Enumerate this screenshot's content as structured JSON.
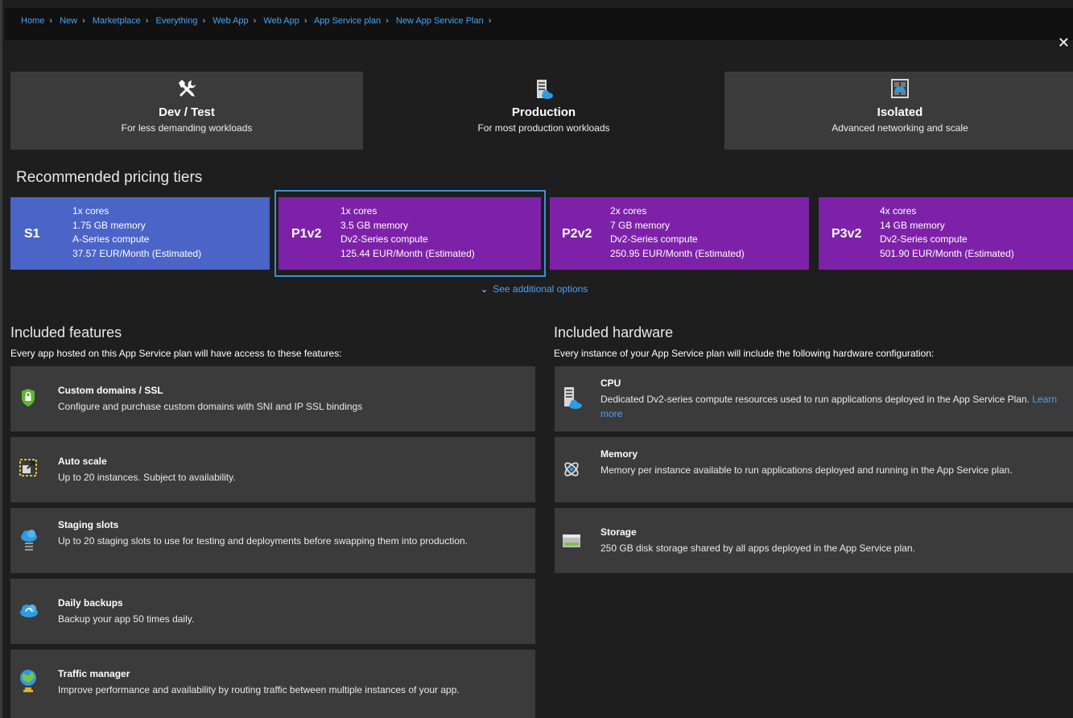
{
  "breadcrumb": [
    "Home",
    "New",
    "Marketplace",
    "Everything",
    "Web App",
    "Web App",
    "App Service plan",
    "New App Service Plan"
  ],
  "breadcrumb_trailing": ">",
  "close_symbol": "✕",
  "tabs": [
    {
      "title": "Dev / Test",
      "subtitle": "For less demanding workloads",
      "icon": "tools-icon"
    },
    {
      "title": "Production",
      "subtitle": "For most production workloads",
      "icon": "server-icon"
    },
    {
      "title": "Isolated",
      "subtitle": "Advanced networking and scale",
      "icon": "network-icon"
    }
  ],
  "recommended": {
    "heading": "Recommended pricing tiers",
    "tiers": [
      {
        "name": "S1",
        "cores": "1x cores",
        "memory": "1.75 GB memory",
        "compute": "A-Series compute",
        "price": "37.57 EUR/Month (Estimated)",
        "color": "#4a64c8"
      },
      {
        "name": "P1v2",
        "cores": "1x cores",
        "memory": "3.5 GB memory",
        "compute": "Dv2-Series compute",
        "price": "125.44 EUR/Month (Estimated)",
        "color": "#7d22a8"
      },
      {
        "name": "P2v2",
        "cores": "2x cores",
        "memory": "7 GB memory",
        "compute": "Dv2-Series compute",
        "price": "250.95 EUR/Month (Estimated)",
        "color": "#7d22a8"
      },
      {
        "name": "P3v2",
        "cores": "4x cores",
        "memory": "14 GB memory",
        "compute": "Dv2-Series compute",
        "price": "501.90 EUR/Month (Estimated)",
        "color": "#7d22a8"
      }
    ],
    "see_more": "See additional options"
  },
  "features": {
    "heading": "Included features",
    "description": "Every app hosted on this App Service plan will have access to these features:",
    "items": [
      {
        "title": "Custom domains / SSL",
        "desc": "Configure and purchase custom domains with SNI and IP SSL bindings",
        "icon": "shield-lock-icon"
      },
      {
        "title": "Auto scale",
        "desc": "Up to 20 instances. Subject to availability.",
        "icon": "autoscale-icon"
      },
      {
        "title": "Staging slots",
        "desc": "Up to 20 staging slots to use for testing and deployments before swapping them into production.",
        "icon": "cloud-slots-icon"
      },
      {
        "title": "Daily backups",
        "desc": "Backup your app 50 times daily.",
        "icon": "cloud-backup-icon"
      },
      {
        "title": "Traffic manager",
        "desc": "Improve performance and availability by routing traffic between multiple instances of your app.",
        "icon": "globe-icon"
      }
    ]
  },
  "hardware": {
    "heading": "Included hardware",
    "description": "Every instance of your App Service plan will include the following hardware configuration:",
    "items": [
      {
        "title": "CPU",
        "desc": "Dedicated Dv2-series compute resources used to run applications deployed in the App Service Plan.",
        "link": "Learn more",
        "icon": "cpu-server-icon"
      },
      {
        "title": "Memory",
        "desc": "Memory per instance available to run applications deployed and running in the App Service plan.",
        "icon": "memory-icon"
      },
      {
        "title": "Storage",
        "desc": "250 GB disk storage shared by all apps deployed in the App Service plan.",
        "icon": "storage-icon"
      }
    ]
  }
}
